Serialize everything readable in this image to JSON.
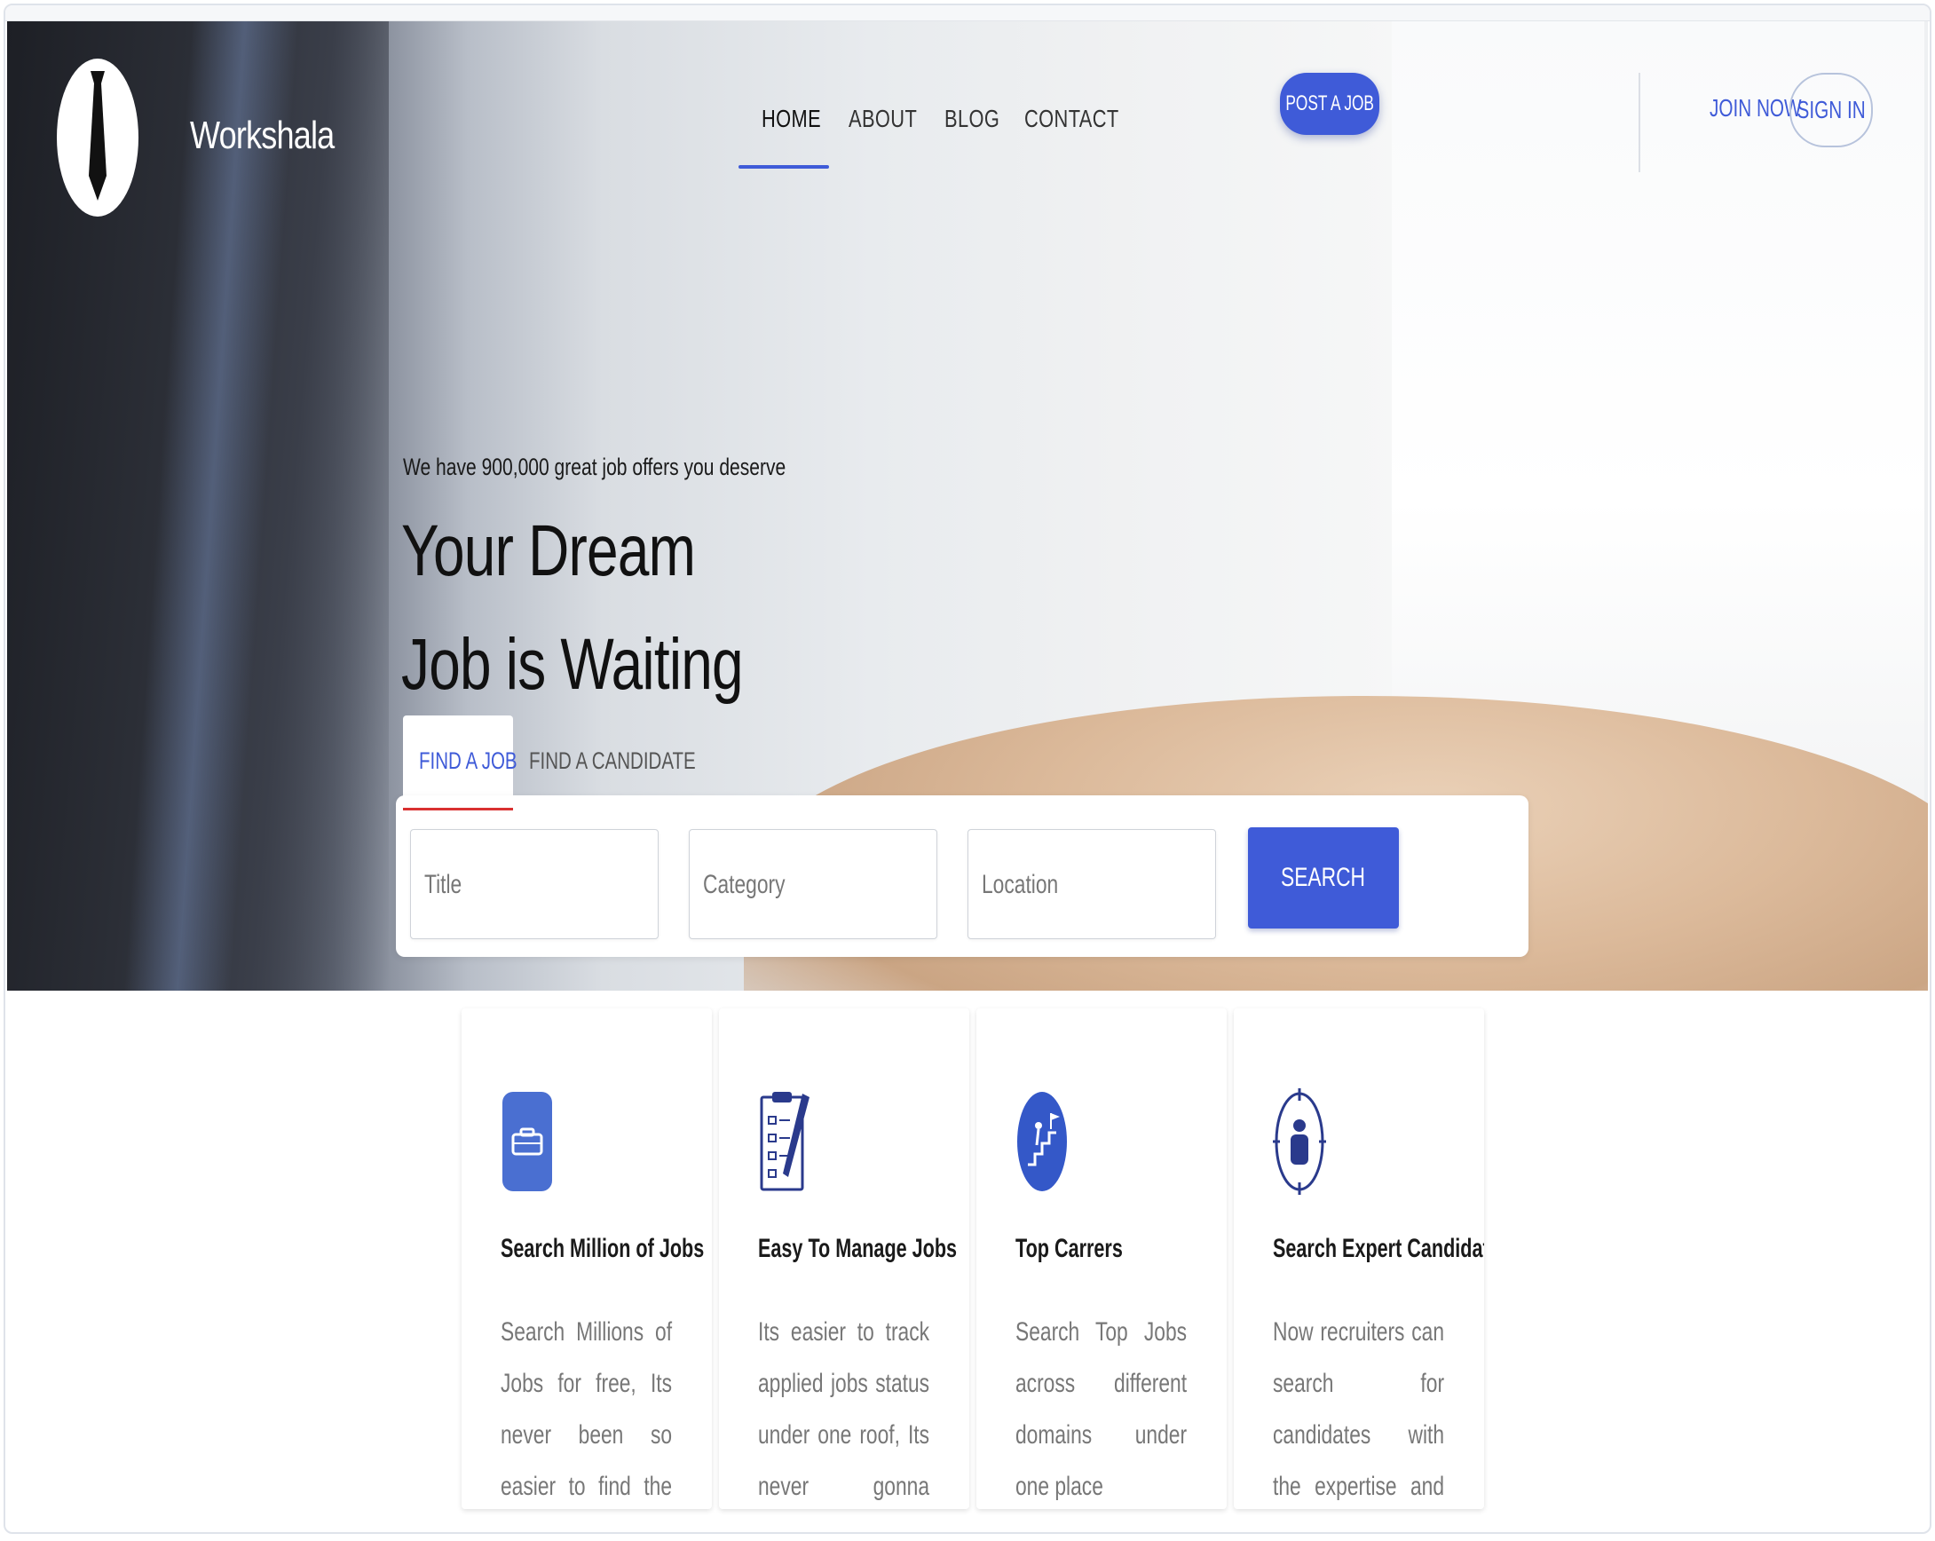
{
  "brand": {
    "name": "Workshala"
  },
  "nav": {
    "items": [
      {
        "label": "HOME",
        "active": true
      },
      {
        "label": "ABOUT"
      },
      {
        "label": "BLOG"
      },
      {
        "label": "CONTACT"
      }
    ],
    "post_job": "POST A JOB",
    "join_now": "JOIN NOW",
    "sign_in": "SIGN IN"
  },
  "hero": {
    "tagline": "We have 900,000 great job offers you deserve",
    "headline_1": "Your Dream",
    "headline_2": "Job is Waiting"
  },
  "search": {
    "tabs": [
      {
        "label": "FIND A JOB",
        "active": true
      },
      {
        "label": "FIND A CANDIDATE"
      }
    ],
    "fields": [
      {
        "placeholder": "Title"
      },
      {
        "placeholder": "Category"
      },
      {
        "placeholder": "Location"
      }
    ],
    "button": "SEARCH"
  },
  "features": [
    {
      "icon": "briefcase-icon",
      "title": "Search Million of Jobs",
      "desc": "Search Millions of Jobs for free, Its never been so easier to find the job at one"
    },
    {
      "icon": "clipboard-icon",
      "title": "Easy To Manage Jobs",
      "desc": "Its easier to track applied jobs status under one roof, Its never gonna easier"
    },
    {
      "icon": "career-ladder-icon",
      "title": "Top Carrers",
      "desc": "Search Top Jobs across different domains under one place"
    },
    {
      "icon": "target-person-icon",
      "title": "Search Expert Candidates",
      "desc": "Now recruiters can search for candidates with the expertise and their experience"
    }
  ],
  "colors": {
    "accent": "#3f5bd8",
    "tab_underline": "#d93030"
  }
}
